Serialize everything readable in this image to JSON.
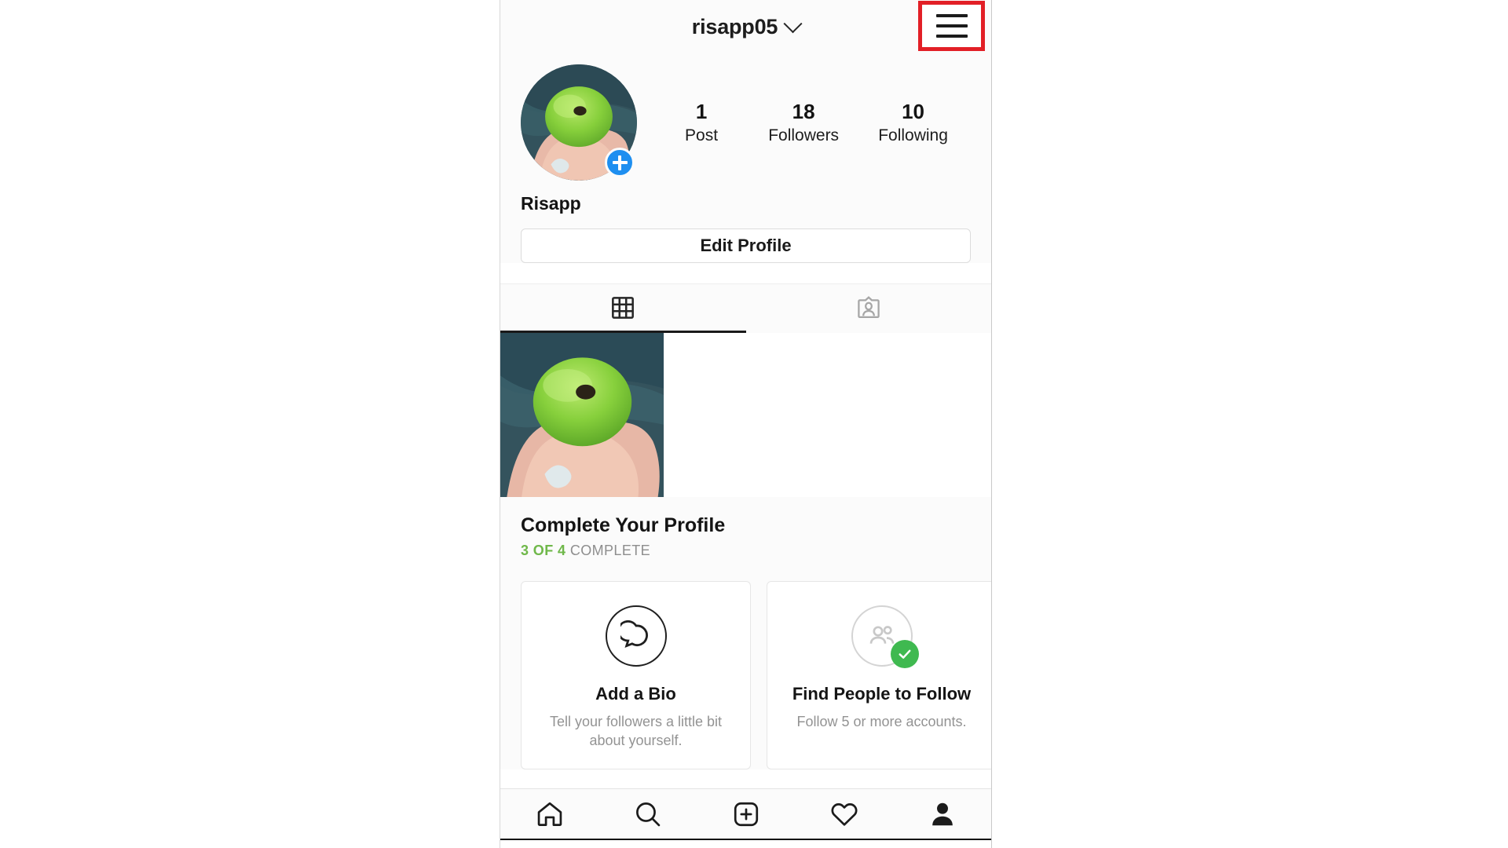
{
  "app": {
    "name": "Instagram",
    "screen": "profile"
  },
  "header": {
    "username": "risapp05",
    "dropdown_icon": "chevron-down-icon",
    "menu_icon": "hamburger-menu-icon",
    "menu_highlight_color": "#e21f26"
  },
  "profile": {
    "avatar_alt": "hand-holding-green-guava",
    "add_story_icon": "plus-icon",
    "add_story_color": "#1e8ff0",
    "display_name": "Risapp",
    "edit_profile_label": "Edit Profile",
    "stats": [
      {
        "count": "1",
        "label": "Post"
      },
      {
        "count": "18",
        "label": "Followers"
      },
      {
        "count": "10",
        "label": "Following"
      }
    ]
  },
  "tabs": [
    {
      "name": "grid-tab",
      "icon": "grid-icon",
      "active": true
    },
    {
      "name": "tagged-tab",
      "icon": "person-card-icon",
      "active": false
    }
  ],
  "posts": [
    {
      "alt": "hand-holding-green-guava"
    }
  ],
  "complete_profile": {
    "title": "Complete Your Profile",
    "progress_done": "3 OF 4",
    "progress_rest": "COMPLETE",
    "progress_color": "#6fb84a",
    "cards": [
      {
        "icon": "speech-bubble-icon",
        "title": "Add a Bio",
        "subtitle": "Tell your followers a little bit about yourself.",
        "completed": false
      },
      {
        "icon": "people-icon",
        "title": "Find People to Follow",
        "subtitle": "Follow 5 or more accounts.",
        "completed": true,
        "check_color": "#3fb950"
      }
    ]
  },
  "bottom_nav": [
    {
      "name": "home",
      "icon": "home-icon",
      "active": false
    },
    {
      "name": "search",
      "icon": "search-icon",
      "active": false
    },
    {
      "name": "create",
      "icon": "plus-square-icon",
      "active": false
    },
    {
      "name": "activity",
      "icon": "heart-icon",
      "active": false
    },
    {
      "name": "profile",
      "icon": "person-filled-icon",
      "active": true
    }
  ]
}
